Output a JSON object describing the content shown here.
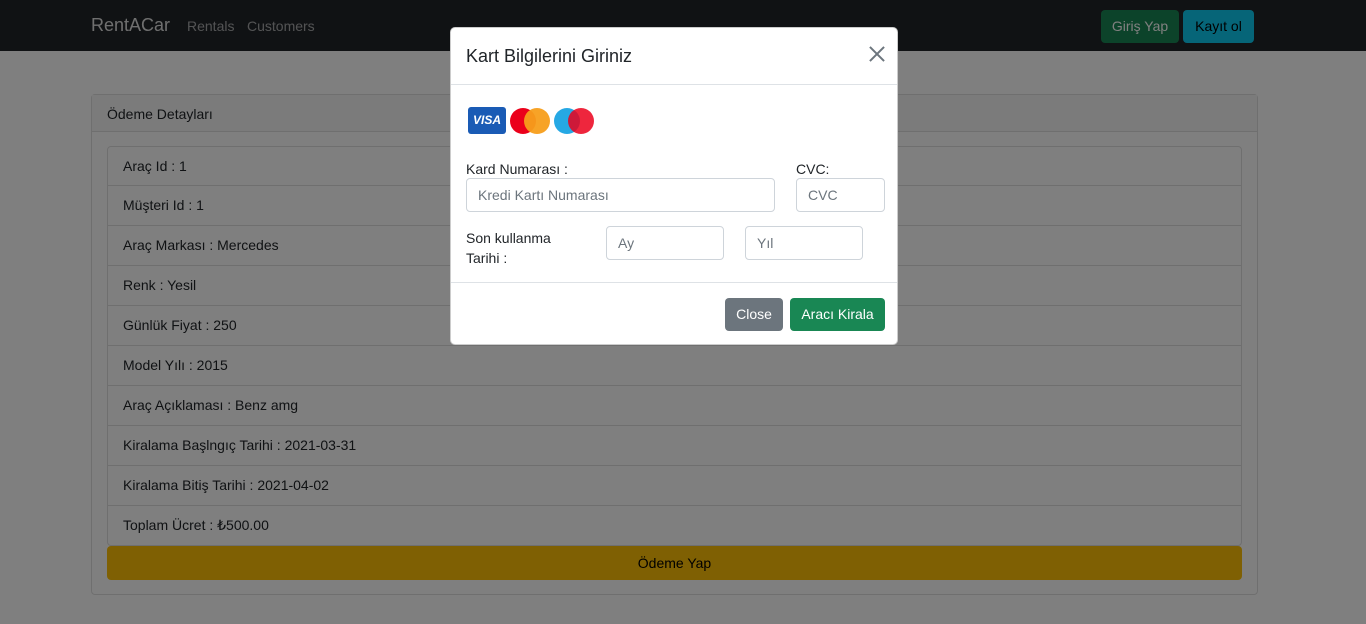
{
  "navbar": {
    "brand": "RentACar",
    "links": [
      "Rentals",
      "Customers"
    ],
    "login_label": "Giriş Yap",
    "register_label": "Kayıt ol"
  },
  "details": {
    "header": "Ödeme Detayları",
    "items": [
      "Araç Id : 1",
      "Müşteri Id : 1",
      "Araç Markası : Mercedes",
      "Renk : Yesil",
      "Günlük Fiyat : 250",
      "Model Yılı : 2015",
      "Araç Açıklaması : Benz amg",
      "Kiralama Başlngıç Tarihi : 2021-03-31",
      "Kiralama Bitiş Tarihi : 2021-04-02",
      "Toplam Ücret : ₺500.00"
    ],
    "pay_label": "Ödeme Yap"
  },
  "modal": {
    "title": "Kart Bilgilerini Giriniz",
    "card_logos": [
      "visa-logo",
      "mastercard-logo",
      "maestro-logo"
    ],
    "visa_text": "VISA",
    "card_number_label": "Kard Numarası :",
    "card_number_placeholder": "Kredi Kartı Numarası",
    "cvc_label": "CVC:",
    "cvc_placeholder": "CVC",
    "expiry_label_line1": "Son kullanma",
    "expiry_label_line2": "Tarihi :",
    "month_placeholder": "Ay",
    "year_placeholder": "Yıl",
    "close_label": "Close",
    "rent_label": "Aracı Kirala"
  },
  "colors": {
    "navbar_bg": "#212529",
    "success": "#198754",
    "info": "#0dcaf0",
    "warning": "#ffc107",
    "secondary": "#6c757d"
  }
}
